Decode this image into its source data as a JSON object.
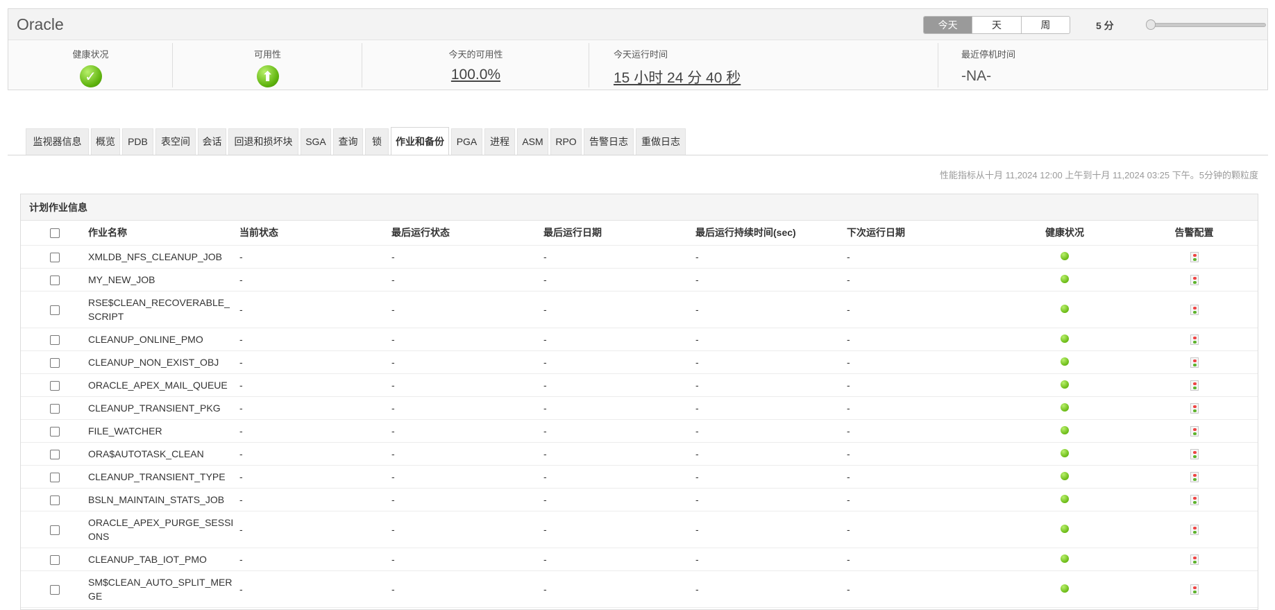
{
  "header": {
    "title": "Oracle",
    "period": {
      "options": [
        "今天",
        "天",
        "周"
      ],
      "selected": "今天"
    },
    "granularity": "5 分",
    "metrics": {
      "health_label": "健康状况",
      "availability_label": "可用性",
      "today_availability_label": "今天的可用性",
      "today_availability_value": "100.0%",
      "today_uptime_label": "今天运行时间",
      "today_uptime_value": "15 小时 24 分 40 秒",
      "last_downtime_label": "最近停机时间",
      "last_downtime_value": "-NA-"
    }
  },
  "tabs": [
    "监视器信息",
    "概览",
    "PDB",
    "表空间",
    "会话",
    "回退和损坏块",
    "SGA",
    "查询",
    "锁",
    "作业和备份",
    "PGA",
    "进程",
    "ASM",
    "RPO",
    "告警日志",
    "重做日志"
  ],
  "active_tab": "作业和备份",
  "perf_note": "性能指标从十月 11,2024 12:00 上午到十月 11,2024 03:25 下午。5分钟的颗粒度",
  "jobs": {
    "title": "计划作业信息",
    "columns": [
      "作业名称",
      "当前状态",
      "最后运行状态",
      "最后运行日期",
      "最后运行持续时间(sec)",
      "下次运行日期",
      "健康状况",
      "告警配置"
    ],
    "rows": [
      {
        "name": "XMLDB_NFS_CLEANUP_JOB",
        "current": "-",
        "last_status": "-",
        "last_date": "-",
        "duration": "-",
        "next": "-"
      },
      {
        "name": "MY_NEW_JOB",
        "current": "-",
        "last_status": "-",
        "last_date": "-",
        "duration": "-",
        "next": "-"
      },
      {
        "name": "RSE$CLEAN_RECOVERABLE_SCRIPT",
        "current": "-",
        "last_status": "-",
        "last_date": "-",
        "duration": "-",
        "next": "-"
      },
      {
        "name": "CLEANUP_ONLINE_PMO",
        "current": "-",
        "last_status": "-",
        "last_date": "-",
        "duration": "-",
        "next": "-"
      },
      {
        "name": "CLEANUP_NON_EXIST_OBJ",
        "current": "-",
        "last_status": "-",
        "last_date": "-",
        "duration": "-",
        "next": "-"
      },
      {
        "name": "ORACLE_APEX_MAIL_QUEUE",
        "current": "-",
        "last_status": "-",
        "last_date": "-",
        "duration": "-",
        "next": "-"
      },
      {
        "name": "CLEANUP_TRANSIENT_PKG",
        "current": "-",
        "last_status": "-",
        "last_date": "-",
        "duration": "-",
        "next": "-"
      },
      {
        "name": "FILE_WATCHER",
        "current": "-",
        "last_status": "-",
        "last_date": "-",
        "duration": "-",
        "next": "-"
      },
      {
        "name": "ORA$AUTOTASK_CLEAN",
        "current": "-",
        "last_status": "-",
        "last_date": "-",
        "duration": "-",
        "next": "-"
      },
      {
        "name": "CLEANUP_TRANSIENT_TYPE",
        "current": "-",
        "last_status": "-",
        "last_date": "-",
        "duration": "-",
        "next": "-"
      },
      {
        "name": "BSLN_MAINTAIN_STATS_JOB",
        "current": "-",
        "last_status": "-",
        "last_date": "-",
        "duration": "-",
        "next": "-"
      },
      {
        "name": "ORACLE_APEX_PURGE_SESSIONS",
        "current": "-",
        "last_status": "-",
        "last_date": "-",
        "duration": "-",
        "next": "-"
      },
      {
        "name": "CLEANUP_TAB_IOT_PMO",
        "current": "-",
        "last_status": "-",
        "last_date": "-",
        "duration": "-",
        "next": "-"
      },
      {
        "name": "SM$CLEAN_AUTO_SPLIT_MERGE",
        "current": "-",
        "last_status": "-",
        "last_date": "-",
        "duration": "-",
        "next": "-"
      }
    ]
  }
}
